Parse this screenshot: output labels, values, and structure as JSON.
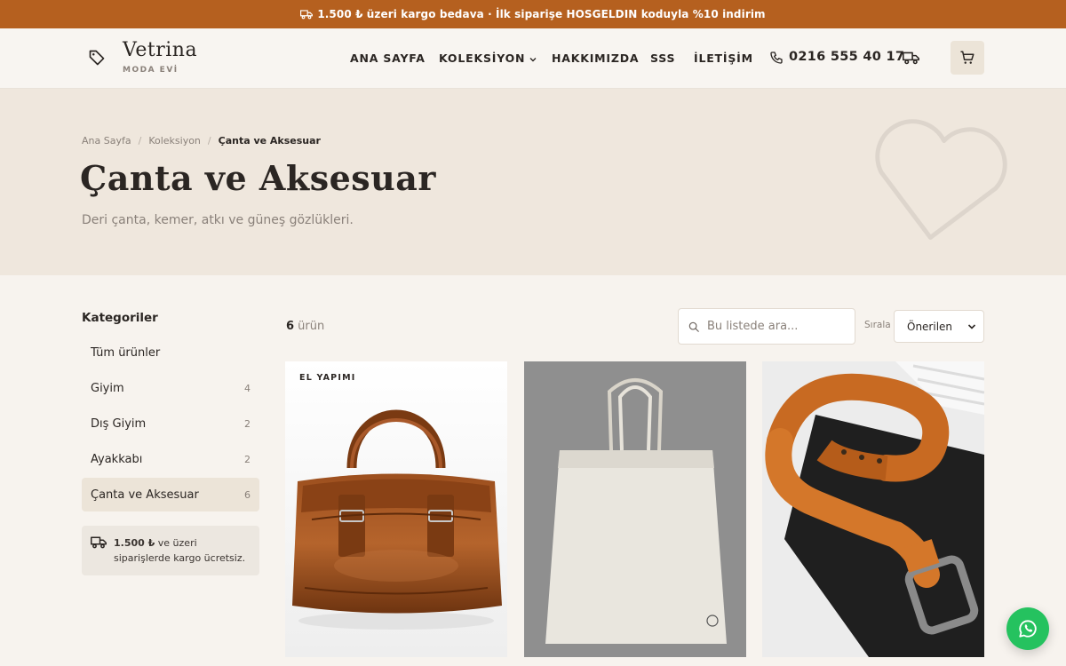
{
  "promo": {
    "text": "1.500 ₺ üzeri kargo bedava · İlk siparişe HOSGELDIN koduyla %10 indirim"
  },
  "header": {
    "brand": "Vetrina",
    "brand_sub": "MODA EVİ",
    "nav": [
      {
        "label": "ANA SAYFA"
      },
      {
        "label": "KOLEKSİYON"
      },
      {
        "label": "HAKKIMIZDA"
      },
      {
        "label": "SSS"
      },
      {
        "label": "İLETİŞİM"
      }
    ],
    "phone": "0216 555 40 17"
  },
  "hero": {
    "breadcrumb": [
      "Ana Sayfa",
      "Koleksiyon",
      "Çanta ve Aksesuar"
    ],
    "title": "Çanta ve Aksesuar",
    "subtitle": "Deri çanta, kemer, atkı ve güneş gözlükleri."
  },
  "sidebar": {
    "title": "Kategoriler",
    "categories": [
      {
        "label": "Tüm ürünler",
        "count": ""
      },
      {
        "label": "Giyim",
        "count": "4"
      },
      {
        "label": "Dış Giyim",
        "count": "2"
      },
      {
        "label": "Ayakkabı",
        "count": "2"
      },
      {
        "label": "Çanta ve Aksesuar",
        "count": "6"
      }
    ],
    "shipping_amount": "1.500 ₺",
    "shipping_text": " ve üzeri siparişlerde kargo ücretsiz."
  },
  "toolbar": {
    "count": "6",
    "count_suffix": " ürün",
    "search_placeholder": "Bu listede ara...",
    "sort_label": "Sırala",
    "sort_value": "Önerilen"
  },
  "products": [
    {
      "badge": "EL YAPIMI"
    },
    {
      "badge": ""
    },
    {
      "badge": ""
    }
  ],
  "colors": {
    "accent": "#b5601f",
    "background": "#f7f3ee",
    "hero": "#efe7dd",
    "active_category": "#ece4d8",
    "whatsapp": "#25c25f"
  }
}
